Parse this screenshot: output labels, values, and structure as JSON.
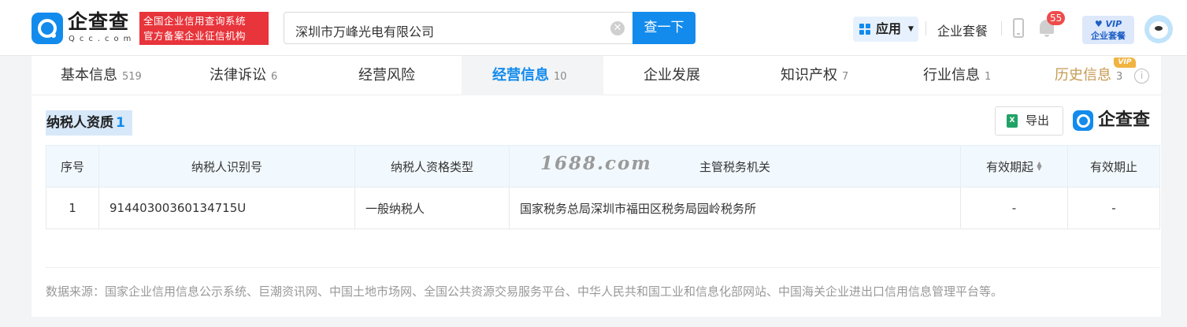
{
  "header": {
    "logo_text": "企查查",
    "logo_sub": "Qcc.com",
    "slogan_line1": "全国企业信用查询系统",
    "slogan_line2": "官方备案企业征信机构",
    "search_value": "深圳市万峰光电有限公司",
    "search_button": "查一下",
    "app_button": "应用",
    "enterprise_package": "企业套餐",
    "notification_count": "55",
    "vip_label": "VIP",
    "vip_sub": "企业套餐"
  },
  "tabs": [
    {
      "label": "基本信息",
      "count": "519"
    },
    {
      "label": "法律诉讼",
      "count": "6"
    },
    {
      "label": "经营风险",
      "count": ""
    },
    {
      "label": "经营信息",
      "count": "10"
    },
    {
      "label": "企业发展",
      "count": ""
    },
    {
      "label": "知识产权",
      "count": "7"
    },
    {
      "label": "行业信息",
      "count": "1"
    },
    {
      "label": "历史信息",
      "count": "3"
    }
  ],
  "history_vip_flag": "VIP",
  "section": {
    "title": "纳税人资质",
    "count": "1",
    "export_label": "导出",
    "brand": "企查查"
  },
  "table": {
    "headers": [
      "序号",
      "纳税人识别号",
      "纳税人资格类型",
      "主管税务机关",
      "有效期起",
      "有效期止"
    ],
    "rows": [
      [
        "1",
        "91440300360134715U",
        "一般纳税人",
        "国家税务总局深圳市福田区税务局园岭税务所",
        "-",
        "-"
      ]
    ]
  },
  "watermark": "1688.com",
  "source_note": "数据来源：国家企业信用信息公示系统、巨潮资讯网、中国土地市场网、全国公共资源交易服务平台、中华人民共和国工业和信息化部网站、中国海关企业进出口信用信息管理平台等。",
  "colors": {
    "brand_blue": "#128bed",
    "slogan_red": "#e8343b",
    "history_gold": "#c69a52",
    "vip_orange": "#f1b341"
  }
}
